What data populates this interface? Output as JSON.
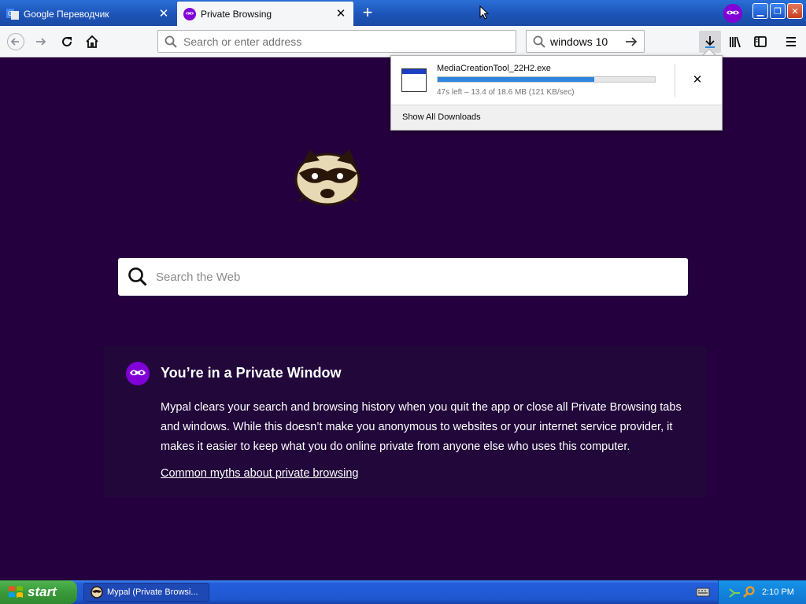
{
  "tabs": [
    {
      "title": "Google Переводчик",
      "active": false
    },
    {
      "title": "Private Browsing",
      "active": true
    }
  ],
  "toolbar": {
    "url_placeholder": "Search or enter address",
    "search_value": "windows 10"
  },
  "download": {
    "filename": "MediaCreationTool_22H2.exe",
    "status": "47s left – 13.4 of 18.6 MB (121 KB/sec)",
    "progress": 0.72,
    "footer": "Show All Downloads"
  },
  "page": {
    "search_placeholder": "Search the Web",
    "card_title": "You’re in a Private Window",
    "card_body": "Mypal clears your search and browsing history when you quit the app or close all Private Browsing tabs and windows. While this doesn’t make you anonymous to websites or your internet service provider, it makes it easier to keep what you do online private from anyone else who uses this computer.",
    "card_link": "Common myths about private browsing"
  },
  "taskbar": {
    "start_label": "start",
    "task_label": "Mypal (Private Browsi...",
    "clock": "2:10 PM"
  },
  "colors": {
    "page_bg": "#25003e",
    "card_bg": "#21073a",
    "private_purple": "#8000d7",
    "progress_fill": "#2e86de"
  }
}
